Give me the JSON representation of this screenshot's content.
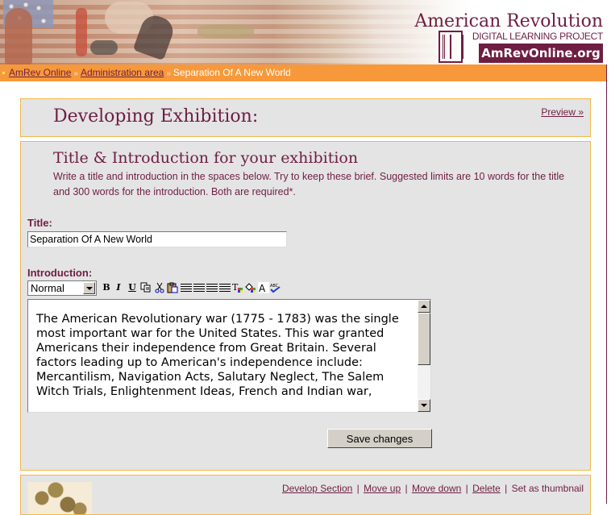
{
  "header": {
    "logo_title": "American Revolution",
    "logo_subtitle": "DIGITAL LEARNING PROJECT",
    "logo_badge": "AmRevOnline.org",
    "logo_mark": "NHH monogram",
    "banner_image": "revolution-collage-banner"
  },
  "breadcrumb": {
    "items": [
      {
        "label": "AmRev Online",
        "link": true
      },
      {
        "label": "Administration area",
        "link": true
      },
      {
        "label": "Separation Of A New World",
        "link": false
      }
    ],
    "separator": "»"
  },
  "heading_box": {
    "title": "Developing Exhibition:",
    "preview_link": "Preview »"
  },
  "title_intro_box": {
    "title": "Title & Introduction for your exhibition",
    "description": "Write a title and introduction in the spaces below. Try to keep these brief. Suggested limits are 10 words for the title and 300 words for the introduction. Both are required*.",
    "title_label": "Title:",
    "title_value": "Separation Of A New World",
    "intro_label": "Introduction:",
    "toolbar": {
      "format_selected": "Normal",
      "buttons": [
        "B",
        "I",
        "U"
      ],
      "icons": [
        "copy-icon",
        "cut-icon",
        "paste-icon",
        "align-left-icon",
        "align-center-icon",
        "align-right-icon",
        "justify-icon",
        "text-color-icon",
        "highlight-color-icon",
        "font-icon",
        "spellcheck-icon"
      ]
    },
    "intro_text": "The American Revolutionary war (1775 - 1783) was the single most important war for the United States. This war granted Americans their independence from Great Britain. Several factors leading up to American's independence include: Mercantilism, Navigation Acts, Salutary Neglect, The Salem Witch Trials, Enlightenment Ideas, French and Indian war,",
    "save_button": "Save changes"
  },
  "section_box": {
    "thumbnail": "coins-thumbnail",
    "actions": [
      "Develop Section",
      "Move up",
      "Move down",
      "Delete"
    ],
    "static_action": "Set as thumbnail"
  },
  "colors": {
    "brand": "#6e1e42",
    "orange_bar": "#f7993a",
    "box_border": "#f2b94a",
    "box_bg": "#e4e4e4"
  }
}
